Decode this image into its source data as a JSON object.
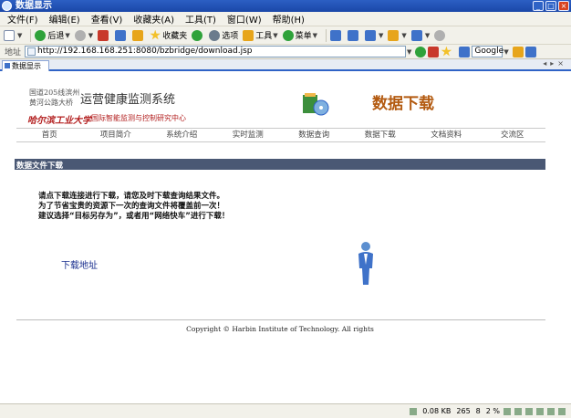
{
  "window": {
    "title": "数据显示",
    "min": "_",
    "max": "□",
    "close": "×"
  },
  "menu": [
    "文件(F)",
    "编辑(E)",
    "查看(V)",
    "收藏夹(A)",
    "工具(T)",
    "窗口(W)",
    "帮助(H)"
  ],
  "toolbar": {
    "back": "后退",
    "favorites": "收藏夹",
    "options": "选项",
    "tools": "工具",
    "menu": "菜单"
  },
  "address": {
    "label": "地址",
    "url": "http://192.168.168.251:8080/bzbridge/download.jsp",
    "search_engine": "Google"
  },
  "tab": {
    "label": "数据显示"
  },
  "site": {
    "header_line1": "国道205线滨州",
    "header_line2": "黄河公路大桥",
    "system_title": "运营健康监测系统",
    "university": "哈尔滨工业大学",
    "center": "国际智能监测与控制研究中心",
    "page_title": "数据下载"
  },
  "nav": [
    "首页",
    "项目简介",
    "系统介绍",
    "实时监测",
    "数据查询",
    "数据下载",
    "文档资料",
    "交流区"
  ],
  "section": {
    "title": "数据文件下载"
  },
  "notes": [
    "请点下载连接进行下载，请您及时下载查询结果文件。",
    "为了节省宝贵的资源下一次的查询文件将覆盖前一次！",
    "建议选择“目标另存为”，或者用“网络快车”进行下载！"
  ],
  "download_link": "下载地址",
  "footer": {
    "copyright": "Copyright © Harbin Institute of Technology. All rights"
  },
  "status": {
    "speed": "0.08 KB",
    "count": "265",
    "pages": "8",
    "percent": "2 %"
  },
  "colors": {
    "accent": "#2f63c6",
    "section_bar": "#4a5874",
    "title_orange": "#b35a10",
    "university_red": "#b32020"
  }
}
